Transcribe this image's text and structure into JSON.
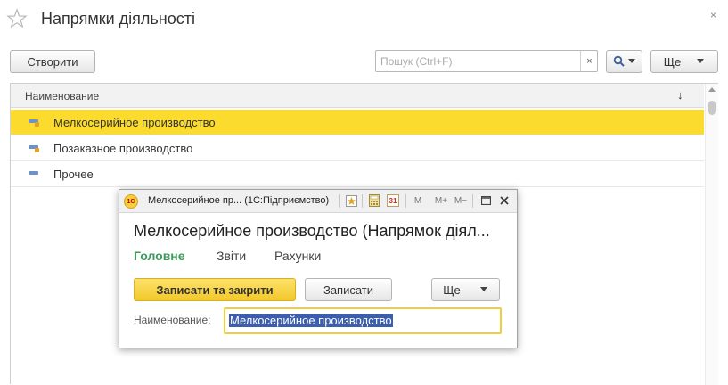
{
  "window": {
    "title": "Напрямки діяльності",
    "close_glyph": "×",
    "favorite_icon": "star-outline-icon"
  },
  "toolbar": {
    "create_label": "Створити",
    "search_placeholder": "Пошук (Ctrl+F)",
    "search_clear_glyph": "×",
    "search_button_icon": "magnifier-dropdown-icon",
    "more_label": "Ще"
  },
  "list": {
    "column_header": "Наименование",
    "sort_glyph": "↓",
    "rows": [
      {
        "label": "Мелкосерийное производство",
        "selected": true
      },
      {
        "label": "Позаказное производство",
        "selected": false
      },
      {
        "label": "Прочее",
        "selected": false
      }
    ]
  },
  "dialog": {
    "window_title": "Мелкосерийное пр...  (1С:Підприємство)",
    "heading": "Мелкосерийное производство (Напрямок діял...",
    "tabs": [
      {
        "label": "Головне",
        "active": true
      },
      {
        "label": "Звіти",
        "active": false
      },
      {
        "label": "Рахунки",
        "active": false
      }
    ],
    "save_close_label": "Записати та закрити",
    "save_label": "Записати",
    "more_label": "Ще",
    "field_label": "Наименование:",
    "field_value": "Мелкосерийное производство",
    "toolbar_labels": {
      "m": "M",
      "m_plus": "M+",
      "m_minus": "M−",
      "calendar": "31",
      "logo": "1C"
    }
  },
  "colors": {
    "selection": "#fbdc2e",
    "primary_button": "#f7d23c",
    "active_tab": "#3c9b5c",
    "text_highlight": "#3b5fae",
    "field_focus_border": "#f0cf3a"
  }
}
